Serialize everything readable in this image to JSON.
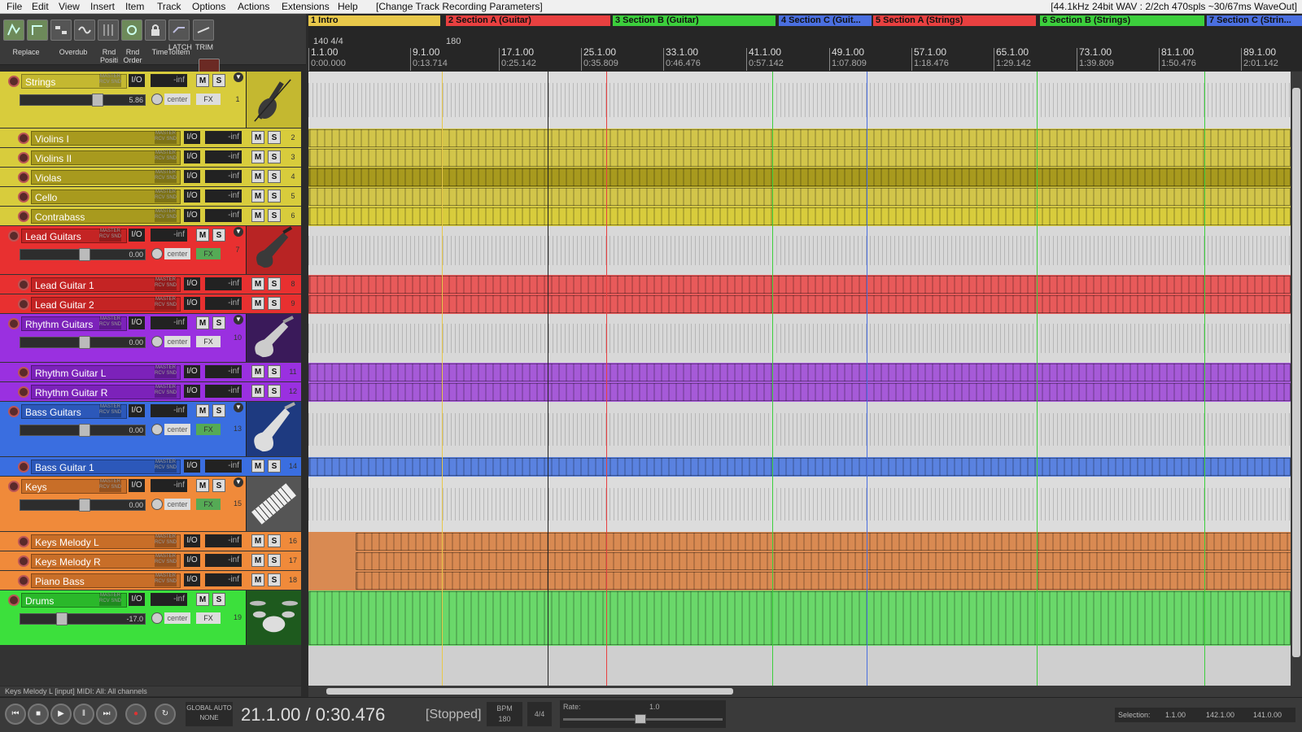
{
  "menu": [
    "File",
    "Edit",
    "View",
    "Insert",
    "Item",
    "Track",
    "Options",
    "Actions",
    "Extensions",
    "Help"
  ],
  "window_title": "[Change Track Recording Parameters]",
  "audio_status": "[44.1kHz 24bit WAV : 2/2ch 470spls ~30/67ms WaveOut]",
  "toolbar": {
    "latch_label": "LATCH",
    "trim_label": "TRIM",
    "replace_label": "Replace",
    "overdub_label": "Overdub",
    "rnd_posit_label": "Rnd Positi",
    "rnd_order_label": "Rnd Order",
    "timetoitem_label": "TimeToItem"
  },
  "tracks": [
    {
      "num": "2",
      "name": "Violins I",
      "level": "-inf"
    },
    {
      "num": "3",
      "name": "Violins II",
      "level": "-inf"
    },
    {
      "num": "4",
      "name": "Violas",
      "level": "-inf"
    },
    {
      "num": "5",
      "name": "Cello",
      "level": "-inf"
    },
    {
      "num": "6",
      "name": "Contrabass",
      "level": "-inf"
    },
    {
      "num": "8",
      "name": "Lead Guitar 1",
      "level": "-inf"
    },
    {
      "num": "9",
      "name": "Lead Guitar 2",
      "level": "-inf"
    },
    {
      "num": "11",
      "name": "Rhythm Guitar L",
      "level": "-inf"
    },
    {
      "num": "12",
      "name": "Rhythm Guitar R",
      "level": "-inf"
    },
    {
      "num": "14",
      "name": "Bass Guitar 1",
      "level": "-inf"
    },
    {
      "num": "16",
      "name": "Keys Melody L",
      "level": "-inf"
    },
    {
      "num": "17",
      "name": "Keys Melody R",
      "level": "-inf"
    },
    {
      "num": "18",
      "name": "Piano Bass",
      "level": "-inf"
    }
  ],
  "folders": [
    {
      "num": "1",
      "name": "Strings",
      "level": "-inf",
      "volume": "5.86",
      "pan": "center"
    },
    {
      "num": "7",
      "name": "Lead Guitars",
      "level": "-inf",
      "volume": "0.00",
      "pan": "center"
    },
    {
      "num": "10",
      "name": "Rhythm Guitars",
      "level": "-inf",
      "volume": "0.00",
      "pan": "center"
    },
    {
      "num": "13",
      "name": "Bass Guitars",
      "level": "-inf",
      "volume": "0.00",
      "pan": "center"
    },
    {
      "num": "15",
      "name": "Keys",
      "level": "-inf",
      "volume": "0.00",
      "pan": "center"
    },
    {
      "num": "19",
      "name": "Drums",
      "level": "-inf",
      "volume": "-17.0",
      "pan": "center"
    }
  ],
  "common": {
    "master_send": "MASTER RCV SND",
    "io": "I/O",
    "mute": "M",
    "solo": "S",
    "fx": "FX"
  },
  "regions": [
    {
      "label": "1 Intro",
      "color": "#e8c84a"
    },
    {
      "label": "2 Section A (Guitar)",
      "color": "#e84040"
    },
    {
      "label": "3 Section B (Guitar)",
      "color": "#3ccf3c"
    },
    {
      "label": "4 Section C (Guit...",
      "color": "#4a6fe0"
    },
    {
      "label": "5 Section A (Strings)",
      "color": "#e84040"
    },
    {
      "label": "6 Section B (Strings)",
      "color": "#3ccf3c"
    },
    {
      "label": "7 Section C (Strin...",
      "color": "#4a6fe0"
    }
  ],
  "tempo_markers": [
    "140 4/4",
    "180"
  ],
  "ruler": [
    {
      "measure": "1.1.00",
      "time": "0:00.000"
    },
    {
      "measure": "9.1.00",
      "time": "0:13.714"
    },
    {
      "measure": "17.1.00",
      "time": "0:25.142"
    },
    {
      "measure": "25.1.00",
      "time": "0:35.809"
    },
    {
      "measure": "33.1.00",
      "time": "0:46.476"
    },
    {
      "measure": "41.1.00",
      "time": "0:57.142"
    },
    {
      "measure": "49.1.00",
      "time": "1:07.809"
    },
    {
      "measure": "57.1.00",
      "time": "1:18.476"
    },
    {
      "measure": "65.1.00",
      "time": "1:29.142"
    },
    {
      "measure": "73.1.00",
      "time": "1:39.809"
    },
    {
      "measure": "81.1.00",
      "time": "1:50.476"
    },
    {
      "measure": "89.1.00",
      "time": "2:01.142"
    }
  ],
  "status_line": "Keys Melody L [input] MIDI: All: All channels",
  "transport": {
    "position": "21.1.00 / 0:30.476",
    "state": "[Stopped]",
    "bpm_label": "BPM",
    "bpm": "180",
    "time_sig": "4/4",
    "rate_label": "Rate:",
    "rate": "1.0",
    "global_auto": "GLOBAL AUTO",
    "global_auto_mode": "NONE",
    "selection_label": "Selection:",
    "sel_start": "1.1.00",
    "sel_end": "142.1.00",
    "sel_len": "141.0.00"
  },
  "colors": {
    "strings": "#d8cc3c",
    "strings_dark": "#a89a1e",
    "lead": "#e83030",
    "rhythm": "#9a30e0",
    "bass": "#3a6ee0",
    "keys": "#f08a3a",
    "drums": "#3ce03c",
    "arrange_bg": "#cfcfcf"
  }
}
